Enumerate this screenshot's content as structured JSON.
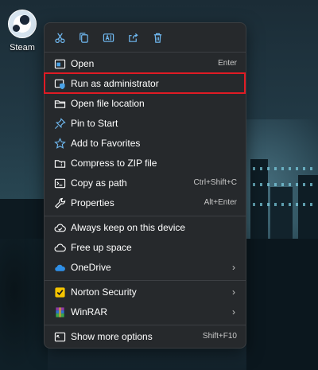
{
  "desktop": {
    "icon_label": "Steam"
  },
  "toolbar": {
    "icons": [
      "cut-icon",
      "copy-icon",
      "rename-icon",
      "share-icon",
      "delete-icon"
    ]
  },
  "menu": {
    "items": [
      {
        "label": "Open",
        "shortcut": "Enter",
        "icon": "open-icon"
      },
      {
        "label": "Run as administrator",
        "shortcut": "",
        "icon": "shield-icon",
        "highlighted": true
      },
      {
        "label": "Open file location",
        "shortcut": "",
        "icon": "folder-icon"
      },
      {
        "label": "Pin to Start",
        "shortcut": "",
        "icon": "pin-icon"
      },
      {
        "label": "Add to Favorites",
        "shortcut": "",
        "icon": "star-icon"
      },
      {
        "label": "Compress to ZIP file",
        "shortcut": "",
        "icon": "zip-icon"
      },
      {
        "label": "Copy as path",
        "shortcut": "Ctrl+Shift+C",
        "icon": "copy-path-icon"
      },
      {
        "label": "Properties",
        "shortcut": "Alt+Enter",
        "icon": "wrench-icon"
      },
      {
        "label": "Always keep on this device",
        "shortcut": "",
        "icon": "cloud-check-icon"
      },
      {
        "label": "Free up space",
        "shortcut": "",
        "icon": "cloud-icon"
      },
      {
        "label": "OneDrive",
        "shortcut": "",
        "icon": "onedrive-icon",
        "submenu": true
      },
      {
        "label": "Norton Security",
        "shortcut": "",
        "icon": "norton-icon",
        "submenu": true
      },
      {
        "label": "WinRAR",
        "shortcut": "",
        "icon": "winrar-icon",
        "submenu": true
      },
      {
        "label": "Show more options",
        "shortcut": "Shift+F10",
        "icon": "more-options-icon"
      }
    ]
  },
  "colors": {
    "menu_bg": "#26292c",
    "accent_blue": "#4aa3e8",
    "highlight_border": "#e01b24",
    "text": "#ffffff"
  }
}
